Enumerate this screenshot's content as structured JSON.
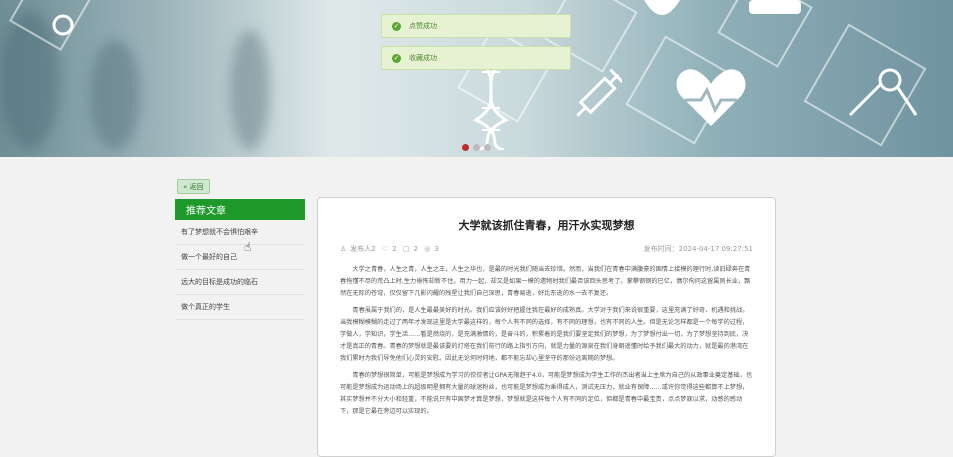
{
  "banner": {
    "alt": "医疗健康 横幅"
  },
  "carousel": {
    "dots": [
      "1",
      "2",
      "3"
    ],
    "active": 0
  },
  "toasts": [
    {
      "text": "点赞成功",
      "icon": "check-icon"
    },
    {
      "text": "收藏成功",
      "icon": "check-icon"
    }
  ],
  "back_label": "« 返回",
  "sidebar": {
    "title": "推荐文章",
    "items": [
      {
        "label": "有了梦想就不会惧怕艰辛"
      },
      {
        "label": "做一个最好的自己"
      },
      {
        "label": "远大的目标是成功的临石"
      },
      {
        "label": "做个真正的学生"
      }
    ]
  },
  "article": {
    "title": "大学就该抓住青春，用汗水实现梦想",
    "author": "发布人2",
    "likes": "2",
    "comments": "2",
    "views": "3",
    "publish_time": "发布时间：2024-04-17 09:27:51",
    "paragraphs": [
      "大学之青春，人生之青，人生之王，人生之华也，是最的时光我们随当去珍惜。然而，当我们在青春中满腹豪的国情上接模的理行时,读旧碌奔在青春拖懂不尽的荒凸上时,生力倦怖却新不住。用力一起，却又是如果一模的遗物时我们最否该回头思考了。掌攀钢钢的已亿，偶尔佝问这留属则长业，飘然在无际的苍穹，仅仅留下几影闪耀的残星让我们自己深思，青春易逝，好比东逝的水一去不复还。",
      "青春虽属于我们的，是人生最最美好的时光。我们应该好好把握住我在最好的成熟真。大学对于我们来说很重要，这里充满了好奇、机遇和挑战。当我模糊模糊的走过了两年才发现这里是大学最这样的，每个人有不同的选择，有不同的理想，也有不同的人生。但是无论怎样都是一个每学的过程，学做人，学知识，学生活……看是燃烧的，是充满激情的，是奋斗的，积累着的是我们要坚定我们的梦想，为了梦想付出一切，为了梦想坚持到底，决才是真正的青春。青春的梦想就是最该要的灯塔在我们前行的路上指引方向，就是力量的源泉在我们身朝遥懂时给予我们最大的动力，就是最的港湾在我们累时为我们导免他们心灵的安慰。因此无论何时何地，都不能忘却心里坚守的那份远离期的梦想。",
      "青春的梦想很简单，可能是梦想成为学习的佼佼者让GPA无限趋于4.0，可能是梦想成为学生工作的杰出者当上主席为自己的从政事业奠定基础，也可能是梦想成为运动场上的超级明星拥有大量的球迷粉丝，也可能是梦想成为乘得成人，测试无压力，就业有保障……或许你觉得这些都算不上梦想，其实梦想并不分大小和轻重，不能说只有中国梦才算是梦想，梦想就是这样每个人有不同的定位，但都是青春中最宝贵，点点梦寐以求，动感的感动下，那是它最在旁边可以实现的。"
    ]
  }
}
